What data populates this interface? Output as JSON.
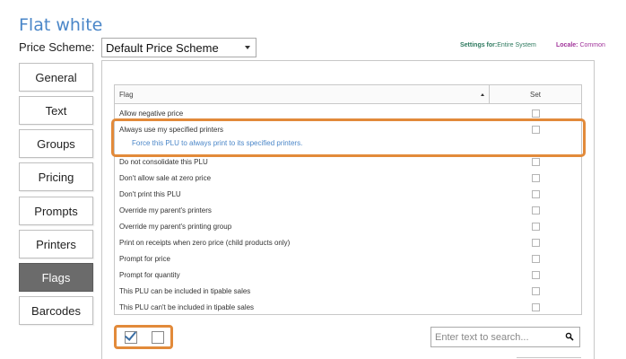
{
  "title": "Flat white",
  "price_scheme": {
    "label": "Price Scheme:",
    "value": "Default Price Scheme"
  },
  "settings_for": {
    "label": "Settings for:",
    "value": "Entire System"
  },
  "locale": {
    "label": "Locale:",
    "value": "Common"
  },
  "tabs": [
    {
      "label": "General",
      "active": false
    },
    {
      "label": "Text",
      "active": false
    },
    {
      "label": "Groups",
      "active": false
    },
    {
      "label": "Pricing",
      "active": false
    },
    {
      "label": "Prompts",
      "active": false
    },
    {
      "label": "Printers",
      "active": false
    },
    {
      "label": "Flags",
      "active": true
    },
    {
      "label": "Barcodes",
      "active": false
    }
  ],
  "grid": {
    "columns": {
      "flag": "Flag",
      "set": "Set"
    },
    "rows": [
      {
        "label": "Allow negative price",
        "checked": false
      },
      {
        "label": "Always use my specified printers",
        "checked": false,
        "description": "Force this PLU to always print to its specified printers."
      },
      {
        "label": "Do not consolidate this PLU",
        "checked": false
      },
      {
        "label": "Don't allow sale at zero price",
        "checked": false
      },
      {
        "label": "Don't print this PLU",
        "checked": false
      },
      {
        "label": "Override my parent's printers",
        "checked": false
      },
      {
        "label": "Override my parent's printing group",
        "checked": false
      },
      {
        "label": "Print on receipts when zero price (child products only)",
        "checked": false
      },
      {
        "label": "Prompt for price",
        "checked": false
      },
      {
        "label": "Prompt for quantity",
        "checked": false
      },
      {
        "label": "This PLU can be included in tipable sales",
        "checked": false
      },
      {
        "label": "This PLU can't be included in tipable sales",
        "checked": false
      }
    ]
  },
  "search": {
    "placeholder": "Enter text to search...",
    "value": ""
  },
  "colors": {
    "title": "#4a86c8",
    "settings_for": "#2e7a5f",
    "locale": "#a0329a",
    "highlight": "#e28a3a",
    "active_tab": "#6b6b6b"
  },
  "icons": {
    "search": "magnifier-icon",
    "sort": "sort-ascending-icon"
  }
}
